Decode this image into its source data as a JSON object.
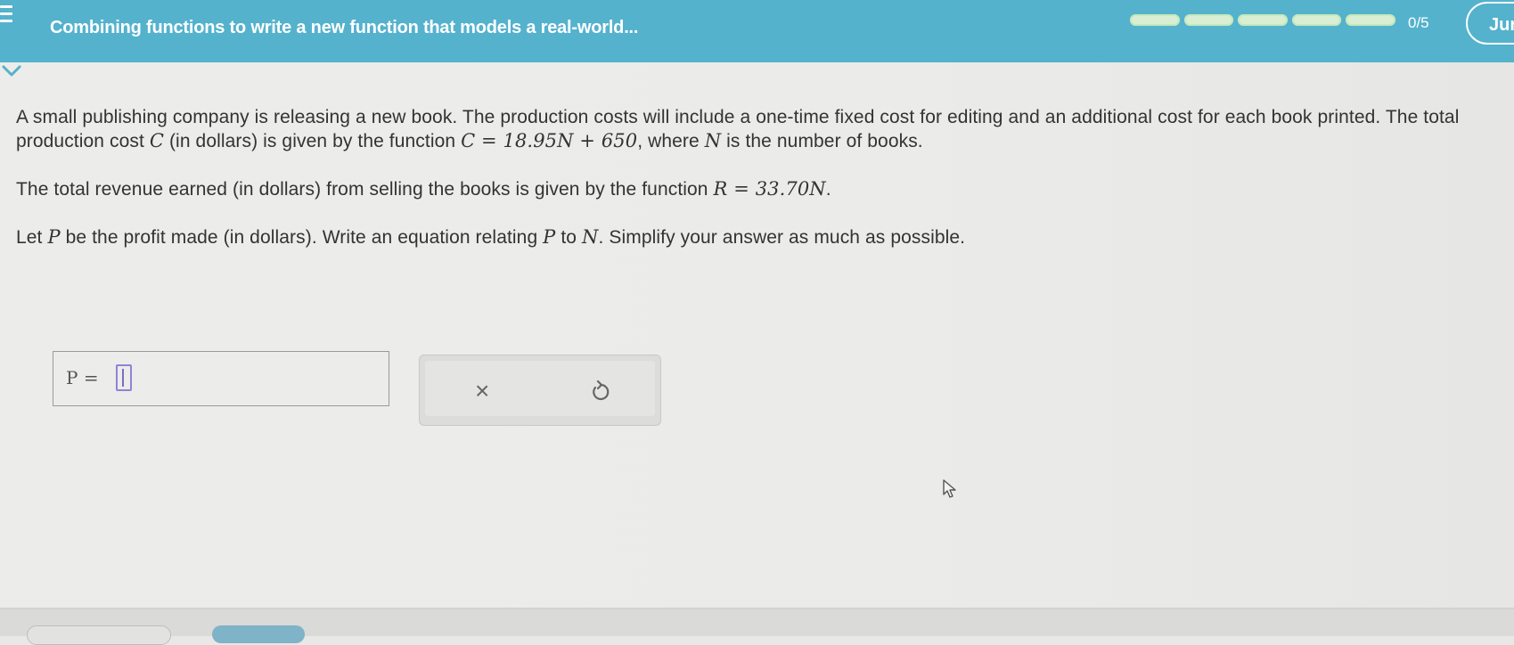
{
  "header": {
    "title": "Combining functions to write a new function that models a real-world...",
    "score": "0/5",
    "jump_label": "Jur",
    "progress_segments": 5,
    "progress_filled": 0,
    "accent_color": "#54b2cd"
  },
  "problem": {
    "p1_a": "A small publishing company is releasing a new book. The production costs will include a one-time fixed cost for editing and an additional cost for each book printed. The total production cost ",
    "p1_var_c": "C",
    "p1_b": " (in dollars) is given by the function ",
    "p1_eq": "C = 18.95N + 650",
    "p1_c": ", where ",
    "p1_var_n": "N",
    "p1_d": " is the number of books.",
    "p2_a": "The total revenue earned (in dollars) from selling the books is given by the function ",
    "p2_eq": "R = 33.70N",
    "p2_b": ".",
    "p3_a": "Let ",
    "p3_var_p": "P",
    "p3_b": " be the profit made (in dollars). Write an equation relating ",
    "p3_var_p2": "P",
    "p3_c": " to ",
    "p3_var_n": "N",
    "p3_d": ". Simplify your answer as much as possible."
  },
  "answer": {
    "label": "P =",
    "value": ""
  },
  "tools": {
    "clear_symbol": "×",
    "undo_icon": "undo-icon"
  }
}
